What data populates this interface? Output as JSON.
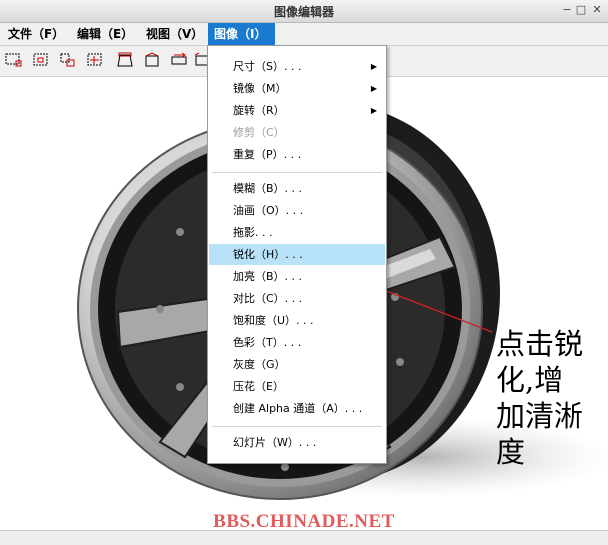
{
  "window": {
    "title": "图像编辑器",
    "minimize": "−",
    "maximize": "□",
    "close": "✕"
  },
  "menubar": [
    "文件（F）",
    "编辑（E）",
    "视图（V）",
    "图像（I）"
  ],
  "toolbar": {
    "icons": [
      "select-rect-icon",
      "crop-rect-icon",
      "crop-corner-icon",
      "crop-center-icon",
      "shape-trapezoid-icon",
      "shape-pentagon-icon",
      "shape-flip-icon",
      "shape-rotate-icon"
    ]
  },
  "menu": {
    "items": [
      {
        "label": "尺寸（S）. . .",
        "submenu": true,
        "disabled": false
      },
      {
        "label": "镜像（M）",
        "submenu": true,
        "disabled": false
      },
      {
        "label": "旋转（R）",
        "submenu": true,
        "disabled": false
      },
      {
        "label": "修剪（C）",
        "submenu": false,
        "disabled": true
      },
      {
        "label": "重复（P）. . .",
        "submenu": false,
        "disabled": false
      },
      {
        "label": "模糊（B）. . .",
        "submenu": false,
        "disabled": false
      },
      {
        "label": "油画（O）. . .",
        "submenu": false,
        "disabled": false
      },
      {
        "label": "拖影. . .",
        "submenu": false,
        "disabled": false
      },
      {
        "label": "锐化（H）. . .",
        "submenu": false,
        "disabled": false
      },
      {
        "label": "加亮（B）. . .",
        "submenu": false,
        "disabled": false
      },
      {
        "label": "对比（C）. . .",
        "submenu": false,
        "disabled": false
      },
      {
        "label": "饱和度（U）. . .",
        "submenu": false,
        "disabled": false
      },
      {
        "label": "色彩（T）. . .",
        "submenu": false,
        "disabled": false
      },
      {
        "label": "灰度（G）",
        "submenu": false,
        "disabled": false
      },
      {
        "label": "压花（E）",
        "submenu": false,
        "disabled": false
      },
      {
        "label": "创建 Alpha 通道（A）. . .",
        "submenu": false,
        "disabled": false
      },
      {
        "label": "幻灯片（W）. . .",
        "submenu": false,
        "disabled": false
      }
    ],
    "highlighted": "锐化（H）. . ."
  },
  "annotation": {
    "lines": [
      "点击锐",
      "化,增",
      "加清淅",
      "度"
    ],
    "color": "#cc2222"
  },
  "watermark": "BBS.CHINADE.NET",
  "colors": {
    "menu_active": "#1a7ad0",
    "highlight": "#b7e2f8",
    "watermark": "#e35a5a"
  }
}
